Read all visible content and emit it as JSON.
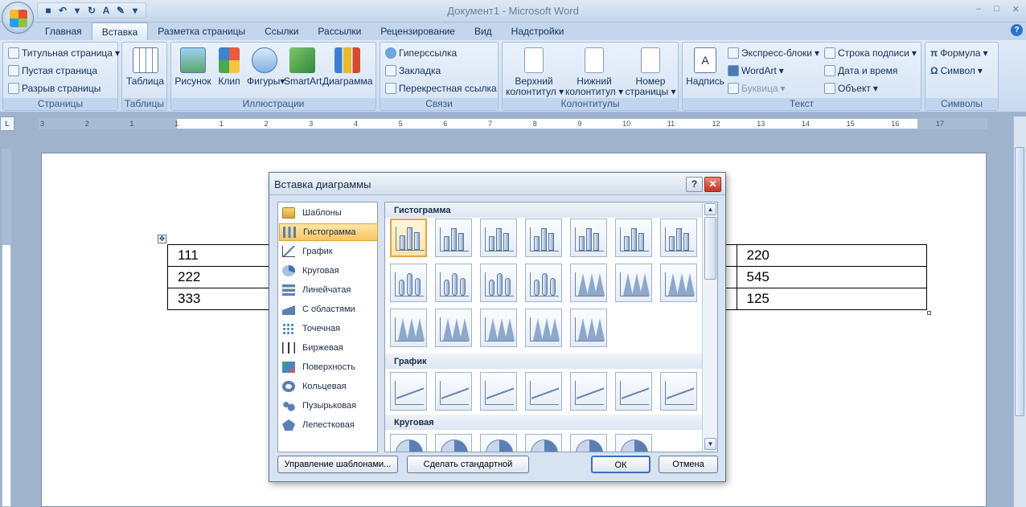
{
  "window": {
    "title": "Документ1 - Microsoft Word",
    "controls": [
      "–",
      "□",
      "✕"
    ]
  },
  "qat": {
    "icons": [
      "save-icon",
      "undo-icon",
      "dropdown-icon",
      "redo-icon",
      "spelling-icon",
      "new-icon",
      "customize-icon"
    ],
    "glyphs": [
      "■",
      "↶",
      "▾",
      "↻",
      "A",
      "✎",
      "▾"
    ]
  },
  "tabs": [
    "Главная",
    "Вставка",
    "Разметка страницы",
    "Ссылки",
    "Рассылки",
    "Рецензирование",
    "Вид",
    "Надстройки"
  ],
  "ribbon": {
    "pages": {
      "label": "Страницы",
      "items": [
        "Титульная страница",
        "Пустая страница",
        "Разрыв страницы"
      ]
    },
    "tables": {
      "label": "Таблицы",
      "table": "Таблица"
    },
    "illustrations": {
      "label": "Иллюстрации",
      "items": [
        "Рисунок",
        "Клип",
        "Фигуры",
        "SmartArt",
        "Диаграмма"
      ]
    },
    "links": {
      "label": "Связи",
      "items": [
        "Гиперссылка",
        "Закладка",
        "Перекрестная ссылка"
      ]
    },
    "headers": {
      "label": "Колонтитулы",
      "header_l1": "Верхний",
      "header_l2": "колонтитул",
      "footer_l1": "Нижний",
      "footer_l2": "колонтитул",
      "pagenum_l1": "Номер",
      "pagenum_l2": "страницы"
    },
    "text": {
      "label": "Текст",
      "textbox": "Надпись",
      "items": [
        "Экспресс-блоки",
        "WordArt",
        "Буквица",
        "Строка подписи",
        "Дата и время",
        "Объект"
      ]
    },
    "symbols": {
      "label": "Символы",
      "formula": "Формула",
      "symbol": "Символ"
    }
  },
  "ruler": {
    "numbers": [
      "3",
      "2",
      "1",
      "1",
      "1",
      "2",
      "3",
      "4",
      "5",
      "6",
      "7",
      "8",
      "9",
      "10",
      "11",
      "12",
      "13",
      "14",
      "15",
      "16",
      "17"
    ]
  },
  "document": {
    "left_table": [
      "111",
      "222",
      "333"
    ],
    "right_table": [
      "220",
      "545",
      "125"
    ]
  },
  "dialog": {
    "title": "Вставка диаграммы",
    "categories": [
      "Шаблоны",
      "Гистограмма",
      "График",
      "Круговая",
      "Линейчатая",
      "С областями",
      "Точечная",
      "Биржевая",
      "Поверхность",
      "Кольцевая",
      "Пузырьковая",
      "Лепестковая"
    ],
    "selected_category": "Гистограмма",
    "sections": [
      "Гистограмма",
      "График",
      "Круговая"
    ],
    "buttons": {
      "manage": "Управление шаблонами...",
      "default": "Сделать стандартной",
      "ok": "ОК",
      "cancel": "Отмена"
    }
  }
}
